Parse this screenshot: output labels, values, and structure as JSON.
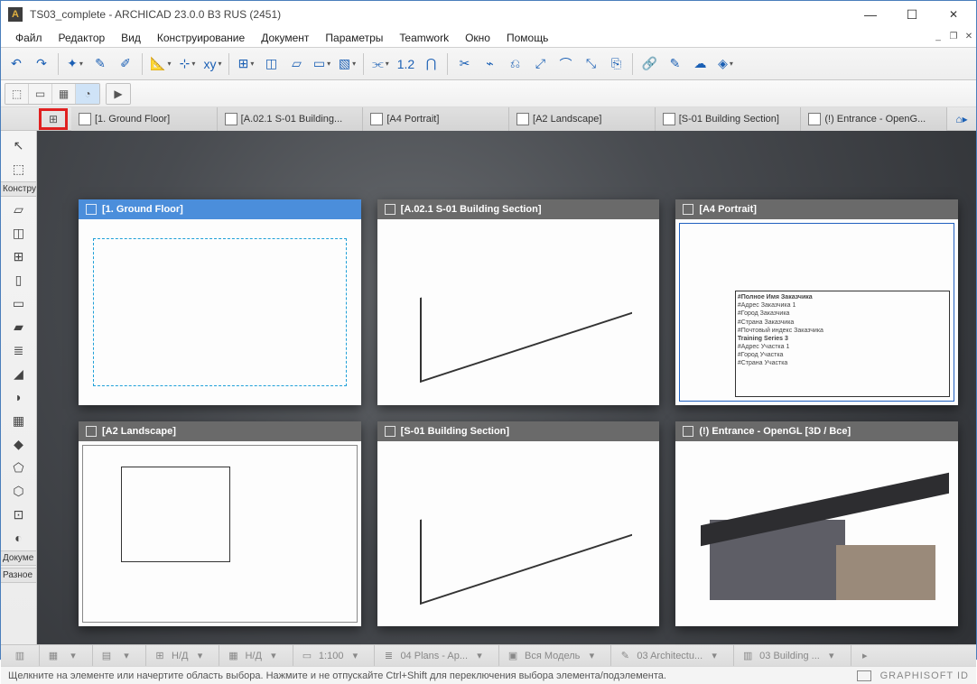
{
  "window": {
    "title": "TS03_complete - ARCHICAD 23.0.0 B3 RUS (2451)"
  },
  "menu": {
    "items": [
      "Файл",
      "Редактор",
      "Вид",
      "Конструирование",
      "Документ",
      "Параметры",
      "Teamwork",
      "Окно",
      "Помощь"
    ]
  },
  "toolbox": {
    "section1": "Констру",
    "section2": "Докуме",
    "section3": "Разное"
  },
  "tabs": {
    "items": [
      {
        "label": "[1. Ground Floor]",
        "icon": "floor-plan-icon"
      },
      {
        "label": "[A.02.1 S-01 Building...",
        "icon": "section-icon"
      },
      {
        "label": "[A4 Portrait]",
        "icon": "layout-icon"
      },
      {
        "label": "[A2 Landscape]",
        "icon": "layout-icon"
      },
      {
        "label": "[S-01 Building Section]",
        "icon": "section-icon"
      },
      {
        "label": "(!) Entrance - OpenG...",
        "icon": "3d-icon"
      }
    ]
  },
  "tiles": [
    {
      "title": "[1. Ground Floor]",
      "selected": true,
      "kind": "floor"
    },
    {
      "title": "[A.02.1 S-01 Building Section]",
      "selected": false,
      "kind": "sec"
    },
    {
      "title": "[A4 Portrait]",
      "selected": false,
      "kind": "a4"
    },
    {
      "title": "[A2 Landscape]",
      "selected": false,
      "kind": "a2"
    },
    {
      "title": "[S-01 Building Section]",
      "selected": false,
      "kind": "sec"
    },
    {
      "title": "(!) Entrance - OpenGL [3D / Все]",
      "selected": false,
      "kind": "3d"
    }
  ],
  "a4_block": {
    "l1": "#Полное Имя Заказчика",
    "l2": "#Адрес Заказчика 1",
    "l3": "#Город Заказчика",
    "l4": "#Страна Заказчика",
    "l5": "#Почтовый индекс Заказчика",
    "l6": "Training Series 3",
    "l7": "#Адрес Участка 1",
    "l8": "#Город Участка",
    "l9": "#Страна Участка"
  },
  "status": {
    "nd": "Н/Д",
    "scale": "1:100",
    "layers": "04 Plans - Ap...",
    "model": "Вся Модель",
    "penset": "03 Architectu...",
    "reno": "03 Building ..."
  },
  "footer": {
    "hint": "Щелкните на элементе или начертите область выбора. Нажмите и не отпускайте Ctrl+Shift для переключения выбора элемента/подэлемента.",
    "brand": "GRAPHISOFT ID"
  }
}
